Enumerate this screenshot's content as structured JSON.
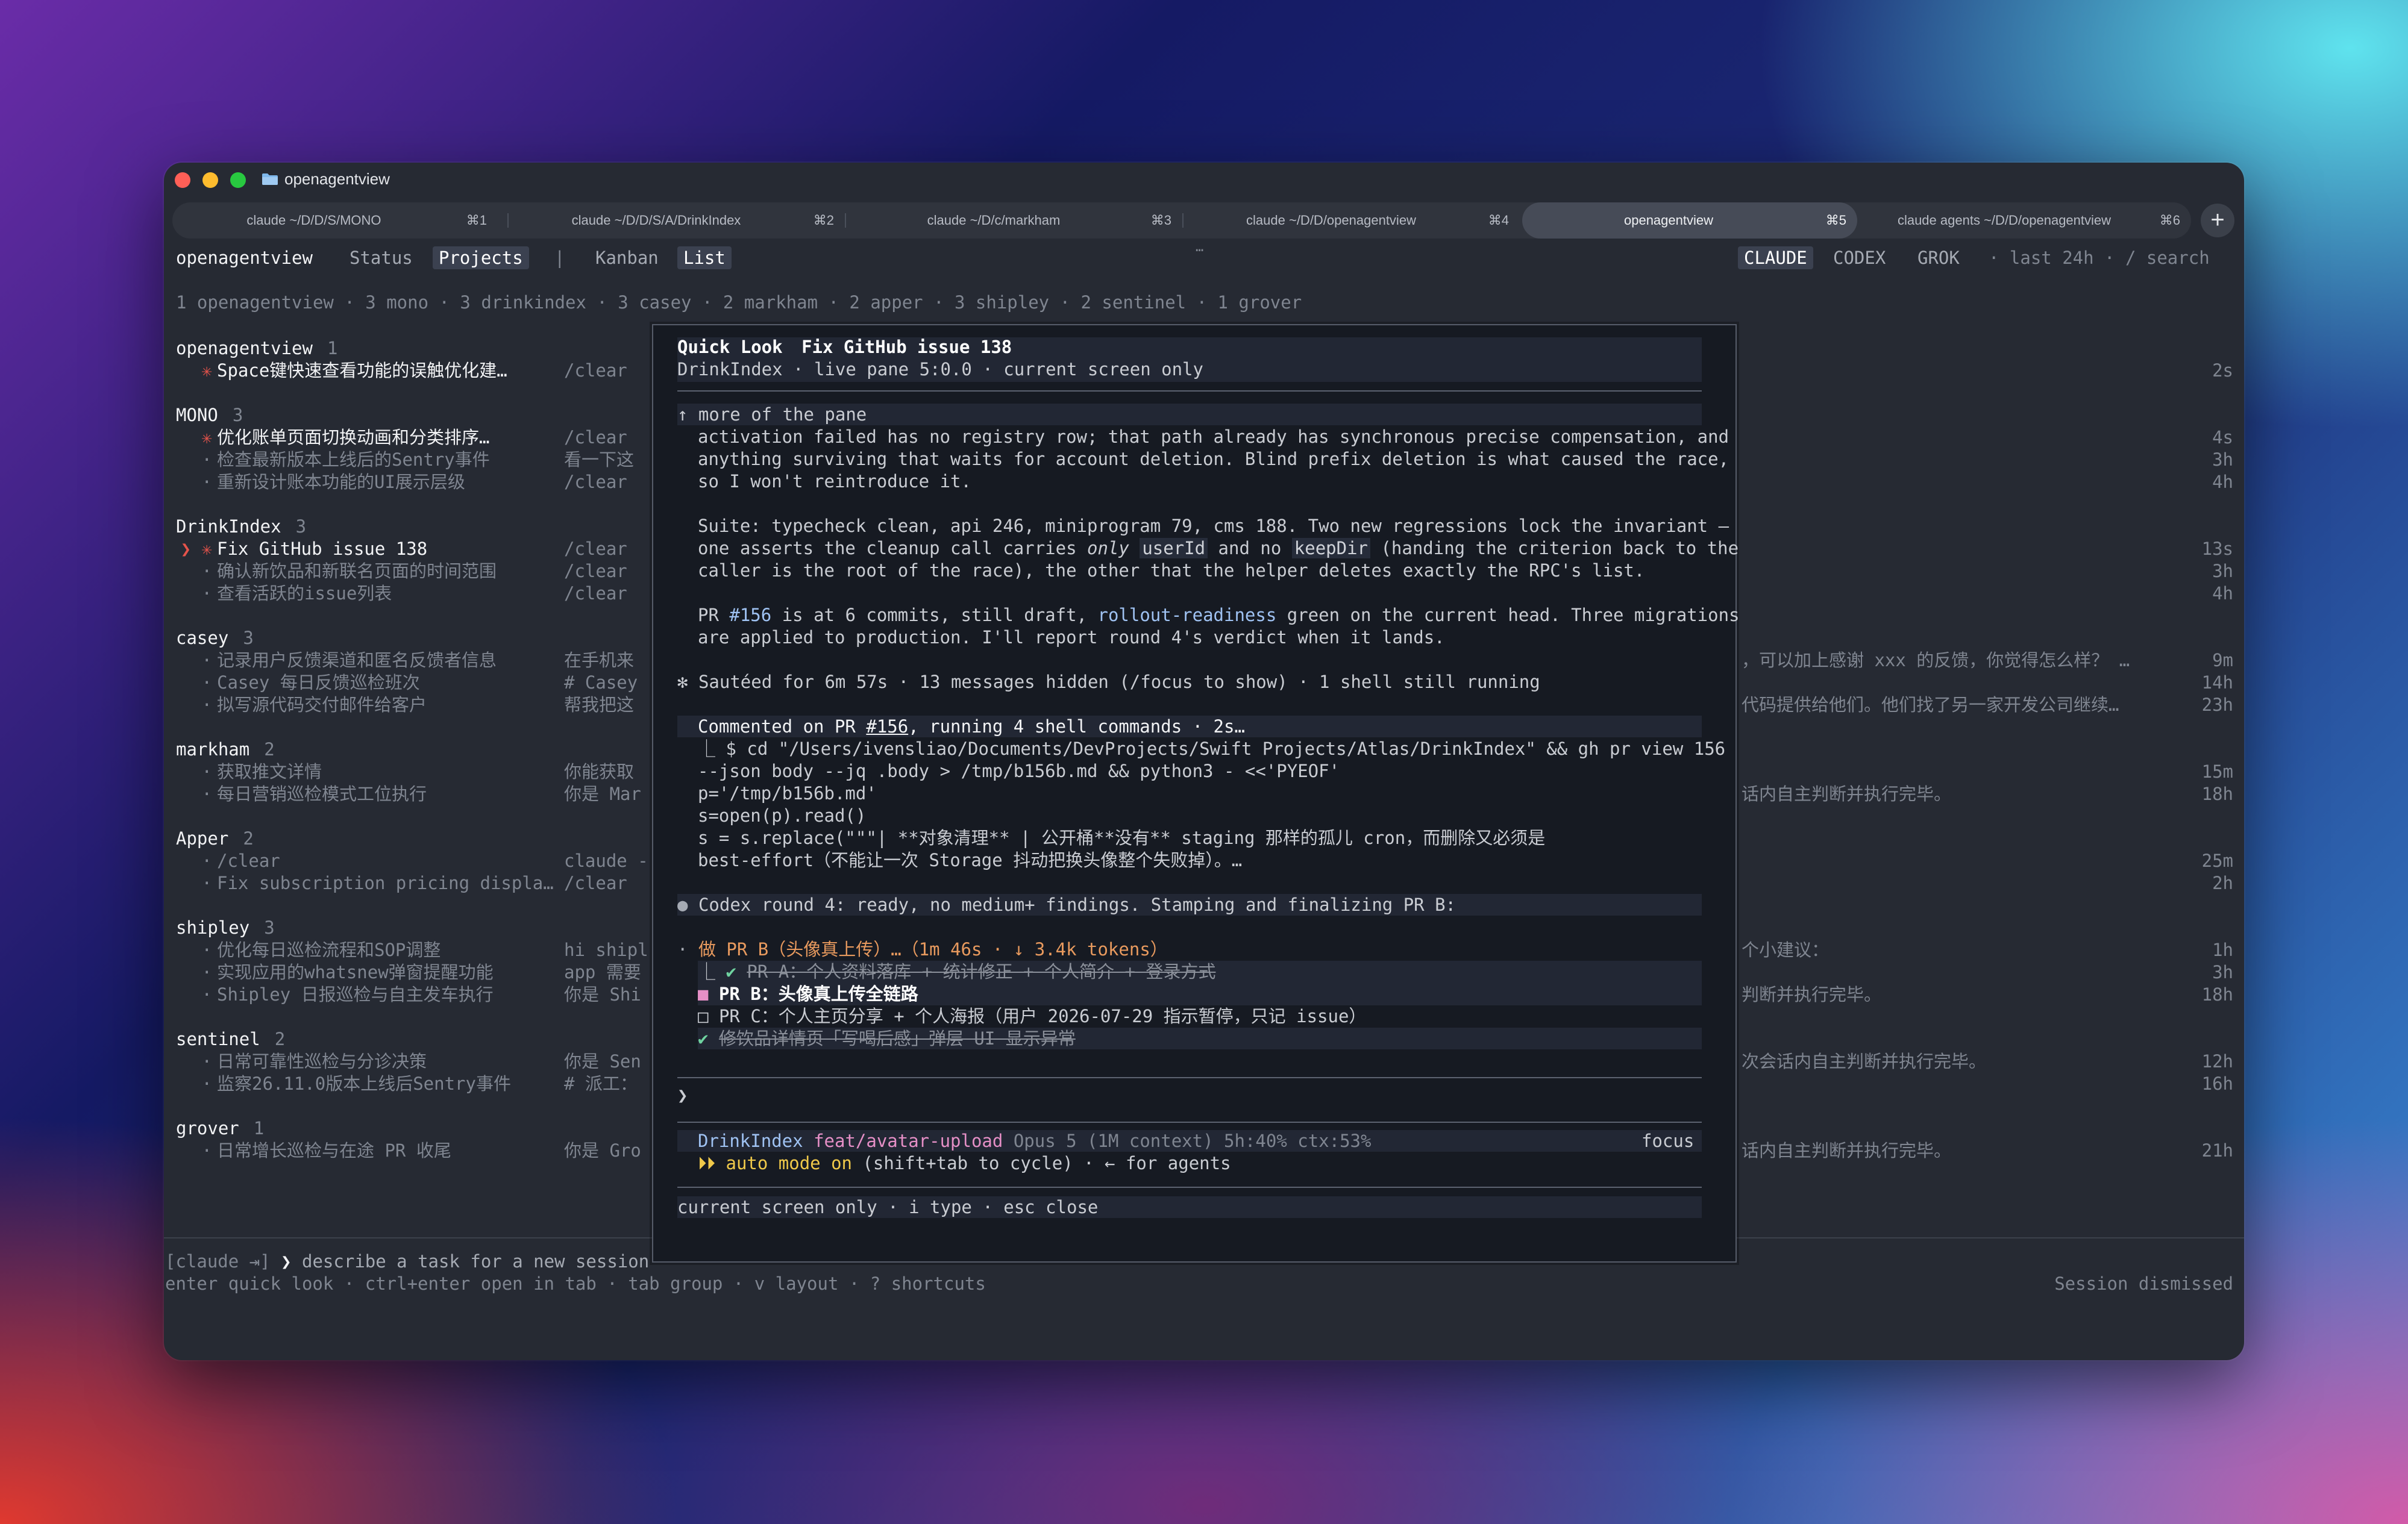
{
  "window": {
    "title": "openagentview"
  },
  "tabs": [
    {
      "label": "claude ~/D/D/S/MONO",
      "key": "⌘1"
    },
    {
      "label": "claude ~/D/D/S/A/DrinkIndex",
      "key": "⌘2"
    },
    {
      "label": "claude ~/D/c/markham",
      "key": "⌘3"
    },
    {
      "label": "claude ~/D/D/openagentview",
      "key": "⌘4"
    },
    {
      "label": "openagentview",
      "key": "⌘5"
    },
    {
      "label": "claude agents ~/D/D/openagentview",
      "key": "⌘6"
    }
  ],
  "add_tab": "+",
  "nav": {
    "app_name": "openagentview",
    "status": "Status",
    "projects": "Projects",
    "kanban": "Kanban",
    "list": "List",
    "agents": [
      "CLAUDE",
      "CODEX",
      "GROK"
    ],
    "right_text": "·  last 24h · / search",
    "dots": "…"
  },
  "summary": "1 openagentview · 3 mono · 3 drinkindex · 3 casey · 2 markham · 2 apper · 3 shipley · 2 sentinel · 1 grover",
  "groups": [
    {
      "name": "openagentview",
      "count": "1",
      "items": [
        {
          "marker": "✳",
          "marker_class": "red",
          "title": "Space键快速查看功能的误触优化建…",
          "snippet": "/clear",
          "right_text": "",
          "time": "2s",
          "bright": true
        }
      ]
    },
    {
      "name": "MONO",
      "count": "3",
      "items": [
        {
          "marker": "✳",
          "marker_class": "red",
          "title": "优化账单页面切换动画和分类排序…",
          "snippet": "/clear",
          "right_text": "",
          "time": "4s",
          "bright": true
        },
        {
          "marker": "·",
          "marker_class": "dim",
          "title": "检查最新版本上线后的Sentry事件",
          "snippet": "看一下这",
          "right_text": "",
          "time": "3h",
          "bright": false
        },
        {
          "marker": "·",
          "marker_class": "dim",
          "title": "重新设计账本功能的UI展示层级",
          "snippet": "/clear",
          "right_text": "",
          "time": "4h",
          "bright": false
        }
      ]
    },
    {
      "name": "DrinkIndex",
      "count": "3",
      "items": [
        {
          "marker": "❯ ✳",
          "marker_class": "red",
          "title": "Fix GitHub issue 138",
          "snippet": "/clear",
          "right_text": "",
          "time": "13s",
          "bright": true
        },
        {
          "marker": "·",
          "marker_class": "dim",
          "title": "确认新饮品和新联名页面的时间范围",
          "snippet": "/clear",
          "right_text": "",
          "time": "3h",
          "bright": false
        },
        {
          "marker": "·",
          "marker_class": "dim",
          "title": "查看活跃的issue列表",
          "snippet": "/clear",
          "right_text": "",
          "time": "4h",
          "bright": false
        }
      ]
    },
    {
      "name": "casey",
      "count": "3",
      "items": [
        {
          "marker": "·",
          "marker_class": "dim",
          "title": "记录用户反馈渠道和匿名反馈者信息",
          "snippet": "在手机来",
          "right_text": "，可以加上感谢 xxx 的反馈，你觉得怎么样？ …",
          "time": "9m",
          "bright": false
        },
        {
          "marker": "·",
          "marker_class": "dim",
          "title": "Casey 每日反馈巡检班次",
          "snippet": "# Casey",
          "right_text": "",
          "time": "14h",
          "bright": false
        },
        {
          "marker": "·",
          "marker_class": "dim",
          "title": "拟写源代码交付邮件给客户",
          "snippet": "帮我把这",
          "right_text": "代码提供给他们。他们找了另一家开发公司继续…",
          "time": "23h",
          "bright": false
        }
      ]
    },
    {
      "name": "markham",
      "count": "2",
      "items": [
        {
          "marker": "·",
          "marker_class": "dim",
          "title": "获取推文详情",
          "snippet": "你能获取",
          "right_text": "",
          "time": "15m",
          "bright": false
        },
        {
          "marker": "·",
          "marker_class": "dim",
          "title": "每日营销巡检模式工位执行",
          "snippet": "你是 Mar",
          "right_text": "话内自主判断并执行完毕。",
          "time": "18h",
          "bright": false
        }
      ]
    },
    {
      "name": "Apper",
      "count": "2",
      "items": [
        {
          "marker": "·",
          "marker_class": "dim",
          "title": "/clear",
          "snippet": "claude -",
          "right_text": "",
          "time": "25m",
          "bright": false
        },
        {
          "marker": "·",
          "marker_class": "dim",
          "title": "Fix subscription pricing displa…",
          "snippet": "/clear",
          "right_text": "",
          "time": "2h",
          "bright": false
        }
      ]
    },
    {
      "name": "shipley",
      "count": "3",
      "items": [
        {
          "marker": "·",
          "marker_class": "dim",
          "title": "优化每日巡检流程和SOP调整",
          "snippet": "hi shipl",
          "right_text": "个小建议：",
          "time": "1h",
          "bright": false
        },
        {
          "marker": "·",
          "marker_class": "dim",
          "title": "实现应用的whatsnew弹窗提醒功能",
          "snippet": "app 需要",
          "right_text": "",
          "time": "3h",
          "bright": false
        },
        {
          "marker": "·",
          "marker_class": "dim",
          "title": "Shipley 日报巡检与自主发车执行",
          "snippet": "你是 Shi",
          "right_text": "判断并执行完毕。",
          "time": "18h",
          "bright": false
        }
      ]
    },
    {
      "name": "sentinel",
      "count": "2",
      "items": [
        {
          "marker": "·",
          "marker_class": "dim",
          "title": "日常可靠性巡检与分诊决策",
          "snippet": "你是 Sen",
          "right_text": "次会话内自主判断并执行完毕。",
          "time": "12h",
          "bright": false
        },
        {
          "marker": "·",
          "marker_class": "dim",
          "title": "监察26.11.0版本上线后Sentry事件",
          "snippet": "# 派工：",
          "right_text": "",
          "time": "16h",
          "bright": false
        }
      ]
    },
    {
      "name": "grover",
      "count": "1",
      "items": [
        {
          "marker": "·",
          "marker_class": "dim",
          "title": "日常增长巡检与在途 PR 收尾",
          "snippet": "你是 Gro",
          "right_text": "话内自主判断并执行完毕。",
          "time": "21h",
          "bright": false
        }
      ]
    }
  ],
  "bottom": {
    "prompt_prefix": "[claude ⇥]",
    "prompt_caret": "❯",
    "prompt_placeholder": "describe a task for a new session",
    "hints": "enter quick look · ctrl+enter open in tab · tab group · v layout · ? shortcuts",
    "status": "Session dismissed"
  },
  "quicklook": {
    "label": "Quick Look",
    "title": "Fix GitHub issue 138",
    "meta": "DrinkIndex · live pane 5:0.0 · current screen only",
    "more": "↑ more of the pane",
    "p1": [
      "activation failed has no registry row; that path already has synchronous precise compensation, and",
      "anything surviving that waits for account deletion. Blind prefix deletion is what caused the race,",
      "so I won't reintroduce it."
    ],
    "p2_l1": "Suite: typecheck clean, api 246, miniprogram 79, cms 188. Two new regressions lock the invariant —",
    "p2_l2_a": "one asserts the cleanup call carries ",
    "p2_l2_em": "only",
    "p2_l2_code1": "userId",
    "p2_l2_b": " and no ",
    "p2_l2_code2": "keepDir",
    "p2_l2_c": " (handing the criterion back to the",
    "p2_l3": "caller is the root of the race), the other that the helper deletes exactly the RPC's list.",
    "p3_a": "PR ",
    "p3_pr": "#156",
    "p3_b": " is at 6 commits, still draft, ",
    "p3_code": "rollout-readiness",
    "p3_c": " green on the current head. Three migrations",
    "p3_l2": "are applied to production. I'll report round 4's verdict when it lands.",
    "sauteed_mark": "✻",
    "sauteed": "Sautéed for 6m 57s · 13 messages hidden (/focus to show) · 1 shell still running",
    "commented_a": "Commented on PR ",
    "commented_pr": "#156",
    "commented_b": ", running 4 shell commands · 2s…",
    "shell": [
      "⎿  $ cd \"/Users/ivensliao/Documents/DevProjects/Swift Projects/Atlas/DrinkIndex\" && gh pr view 156",
      "   --json body --jq .body > /tmp/b156b.md && python3 - <<'PYEOF'",
      "   p='/tmp/b156b.md'",
      "   s=open(p).read()",
      "   s = s.replace(\"\"\"| **对象清理** | 公开桶**没有** staging 那样的孤儿 cron，而删除又必须是",
      "   best-effort（不能让一次 Storage 抖动把换头像整个失败掉）。…"
    ],
    "codex_mark": "●",
    "codex": "Codex round 4: ready, no medium+ findings. Stamping and finalizing PR B:",
    "task_mark": "·",
    "task_line": "做 PR B（头像真上传）…（1m 46s · ↓ 3.4k tokens）",
    "todos": [
      {
        "pre": "⎿  ",
        "mark": "✔",
        "text": "PR A：个人资料落库 + 统计修正 + 个人简介 + 登录方式",
        "state": "done"
      },
      {
        "pre": "   ",
        "mark": "■",
        "text": "PR B：头像真上传全链路",
        "state": "active"
      },
      {
        "pre": "   ",
        "mark": "□",
        "text": "PR C：个人主页分享 + 个人海报（用户 2026-07-29 指示暂停，只记 issue）",
        "state": "pending"
      },
      {
        "pre": "   ",
        "mark": "✔",
        "text": "修饮品详情页「写喝后感」弹层 UI 显示异常",
        "state": "done"
      }
    ],
    "prompt": "❯",
    "status_project": "DrinkIndex",
    "status_branch": "feat/avatar-upload",
    "status_model": "Opus 5 (1M context) 5h:40% ctx:53%",
    "status_focus": "focus",
    "auto_mark": "⏵⏵",
    "auto_mode": "auto mode on",
    "auto_rest": " (shift+tab to cycle) · ← for agents",
    "footer": "current screen only · i type · esc close"
  },
  "colors": {
    "background_window": "#262a33",
    "quicklook_bg": "#161a22",
    "accent_red": "#e5534b",
    "accent_blue": "#9fc2f2",
    "accent_pink": "#e58fc6",
    "accent_yellow": "#f0c94a"
  },
  "icons": [
    "close-light",
    "minimize-light",
    "zoom-light",
    "folder-icon",
    "plus-icon"
  ]
}
